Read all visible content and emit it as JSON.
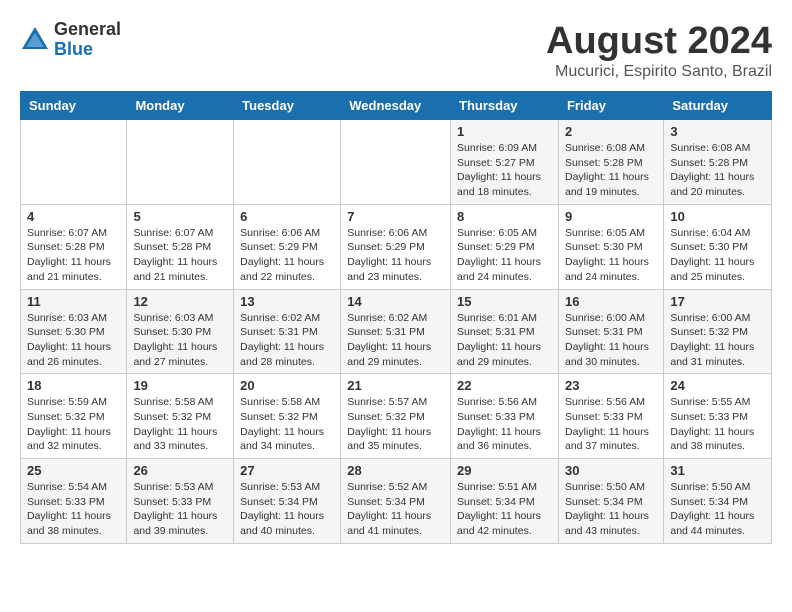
{
  "logo": {
    "general": "General",
    "blue": "Blue"
  },
  "title": {
    "month_year": "August 2024",
    "location": "Mucurici, Espirito Santo, Brazil"
  },
  "days_of_week": [
    "Sunday",
    "Monday",
    "Tuesday",
    "Wednesday",
    "Thursday",
    "Friday",
    "Saturday"
  ],
  "weeks": [
    [
      {
        "day": "",
        "content": ""
      },
      {
        "day": "",
        "content": ""
      },
      {
        "day": "",
        "content": ""
      },
      {
        "day": "",
        "content": ""
      },
      {
        "day": "1",
        "content": "Sunrise: 6:09 AM\nSunset: 5:27 PM\nDaylight: 11 hours\nand 18 minutes."
      },
      {
        "day": "2",
        "content": "Sunrise: 6:08 AM\nSunset: 5:28 PM\nDaylight: 11 hours\nand 19 minutes."
      },
      {
        "day": "3",
        "content": "Sunrise: 6:08 AM\nSunset: 5:28 PM\nDaylight: 11 hours\nand 20 minutes."
      }
    ],
    [
      {
        "day": "4",
        "content": "Sunrise: 6:07 AM\nSunset: 5:28 PM\nDaylight: 11 hours\nand 21 minutes."
      },
      {
        "day": "5",
        "content": "Sunrise: 6:07 AM\nSunset: 5:28 PM\nDaylight: 11 hours\nand 21 minutes."
      },
      {
        "day": "6",
        "content": "Sunrise: 6:06 AM\nSunset: 5:29 PM\nDaylight: 11 hours\nand 22 minutes."
      },
      {
        "day": "7",
        "content": "Sunrise: 6:06 AM\nSunset: 5:29 PM\nDaylight: 11 hours\nand 23 minutes."
      },
      {
        "day": "8",
        "content": "Sunrise: 6:05 AM\nSunset: 5:29 PM\nDaylight: 11 hours\nand 24 minutes."
      },
      {
        "day": "9",
        "content": "Sunrise: 6:05 AM\nSunset: 5:30 PM\nDaylight: 11 hours\nand 24 minutes."
      },
      {
        "day": "10",
        "content": "Sunrise: 6:04 AM\nSunset: 5:30 PM\nDaylight: 11 hours\nand 25 minutes."
      }
    ],
    [
      {
        "day": "11",
        "content": "Sunrise: 6:03 AM\nSunset: 5:30 PM\nDaylight: 11 hours\nand 26 minutes."
      },
      {
        "day": "12",
        "content": "Sunrise: 6:03 AM\nSunset: 5:30 PM\nDaylight: 11 hours\nand 27 minutes."
      },
      {
        "day": "13",
        "content": "Sunrise: 6:02 AM\nSunset: 5:31 PM\nDaylight: 11 hours\nand 28 minutes."
      },
      {
        "day": "14",
        "content": "Sunrise: 6:02 AM\nSunset: 5:31 PM\nDaylight: 11 hours\nand 29 minutes."
      },
      {
        "day": "15",
        "content": "Sunrise: 6:01 AM\nSunset: 5:31 PM\nDaylight: 11 hours\nand 29 minutes."
      },
      {
        "day": "16",
        "content": "Sunrise: 6:00 AM\nSunset: 5:31 PM\nDaylight: 11 hours\nand 30 minutes."
      },
      {
        "day": "17",
        "content": "Sunrise: 6:00 AM\nSunset: 5:32 PM\nDaylight: 11 hours\nand 31 minutes."
      }
    ],
    [
      {
        "day": "18",
        "content": "Sunrise: 5:59 AM\nSunset: 5:32 PM\nDaylight: 11 hours\nand 32 minutes."
      },
      {
        "day": "19",
        "content": "Sunrise: 5:58 AM\nSunset: 5:32 PM\nDaylight: 11 hours\nand 33 minutes."
      },
      {
        "day": "20",
        "content": "Sunrise: 5:58 AM\nSunset: 5:32 PM\nDaylight: 11 hours\nand 34 minutes."
      },
      {
        "day": "21",
        "content": "Sunrise: 5:57 AM\nSunset: 5:32 PM\nDaylight: 11 hours\nand 35 minutes."
      },
      {
        "day": "22",
        "content": "Sunrise: 5:56 AM\nSunset: 5:33 PM\nDaylight: 11 hours\nand 36 minutes."
      },
      {
        "day": "23",
        "content": "Sunrise: 5:56 AM\nSunset: 5:33 PM\nDaylight: 11 hours\nand 37 minutes."
      },
      {
        "day": "24",
        "content": "Sunrise: 5:55 AM\nSunset: 5:33 PM\nDaylight: 11 hours\nand 38 minutes."
      }
    ],
    [
      {
        "day": "25",
        "content": "Sunrise: 5:54 AM\nSunset: 5:33 PM\nDaylight: 11 hours\nand 38 minutes."
      },
      {
        "day": "26",
        "content": "Sunrise: 5:53 AM\nSunset: 5:33 PM\nDaylight: 11 hours\nand 39 minutes."
      },
      {
        "day": "27",
        "content": "Sunrise: 5:53 AM\nSunset: 5:34 PM\nDaylight: 11 hours\nand 40 minutes."
      },
      {
        "day": "28",
        "content": "Sunrise: 5:52 AM\nSunset: 5:34 PM\nDaylight: 11 hours\nand 41 minutes."
      },
      {
        "day": "29",
        "content": "Sunrise: 5:51 AM\nSunset: 5:34 PM\nDaylight: 11 hours\nand 42 minutes."
      },
      {
        "day": "30",
        "content": "Sunrise: 5:50 AM\nSunset: 5:34 PM\nDaylight: 11 hours\nand 43 minutes."
      },
      {
        "day": "31",
        "content": "Sunrise: 5:50 AM\nSunset: 5:34 PM\nDaylight: 11 hours\nand 44 minutes."
      }
    ]
  ]
}
